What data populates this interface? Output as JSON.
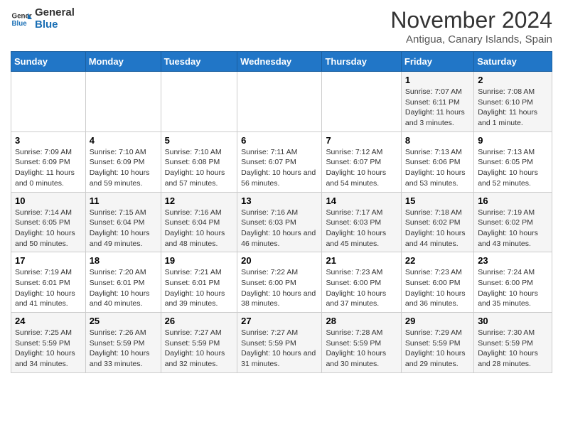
{
  "header": {
    "logo_general": "General",
    "logo_blue": "Blue",
    "month_title": "November 2024",
    "location": "Antigua, Canary Islands, Spain"
  },
  "calendar": {
    "columns": [
      "Sunday",
      "Monday",
      "Tuesday",
      "Wednesday",
      "Thursday",
      "Friday",
      "Saturday"
    ],
    "weeks": [
      [
        {
          "day": "",
          "info": ""
        },
        {
          "day": "",
          "info": ""
        },
        {
          "day": "",
          "info": ""
        },
        {
          "day": "",
          "info": ""
        },
        {
          "day": "",
          "info": ""
        },
        {
          "day": "1",
          "info": "Sunrise: 7:07 AM\nSunset: 6:11 PM\nDaylight: 11 hours and 3 minutes."
        },
        {
          "day": "2",
          "info": "Sunrise: 7:08 AM\nSunset: 6:10 PM\nDaylight: 11 hours and 1 minute."
        }
      ],
      [
        {
          "day": "3",
          "info": "Sunrise: 7:09 AM\nSunset: 6:09 PM\nDaylight: 11 hours and 0 minutes."
        },
        {
          "day": "4",
          "info": "Sunrise: 7:10 AM\nSunset: 6:09 PM\nDaylight: 10 hours and 59 minutes."
        },
        {
          "day": "5",
          "info": "Sunrise: 7:10 AM\nSunset: 6:08 PM\nDaylight: 10 hours and 57 minutes."
        },
        {
          "day": "6",
          "info": "Sunrise: 7:11 AM\nSunset: 6:07 PM\nDaylight: 10 hours and 56 minutes."
        },
        {
          "day": "7",
          "info": "Sunrise: 7:12 AM\nSunset: 6:07 PM\nDaylight: 10 hours and 54 minutes."
        },
        {
          "day": "8",
          "info": "Sunrise: 7:13 AM\nSunset: 6:06 PM\nDaylight: 10 hours and 53 minutes."
        },
        {
          "day": "9",
          "info": "Sunrise: 7:13 AM\nSunset: 6:05 PM\nDaylight: 10 hours and 52 minutes."
        }
      ],
      [
        {
          "day": "10",
          "info": "Sunrise: 7:14 AM\nSunset: 6:05 PM\nDaylight: 10 hours and 50 minutes."
        },
        {
          "day": "11",
          "info": "Sunrise: 7:15 AM\nSunset: 6:04 PM\nDaylight: 10 hours and 49 minutes."
        },
        {
          "day": "12",
          "info": "Sunrise: 7:16 AM\nSunset: 6:04 PM\nDaylight: 10 hours and 48 minutes."
        },
        {
          "day": "13",
          "info": "Sunrise: 7:16 AM\nSunset: 6:03 PM\nDaylight: 10 hours and 46 minutes."
        },
        {
          "day": "14",
          "info": "Sunrise: 7:17 AM\nSunset: 6:03 PM\nDaylight: 10 hours and 45 minutes."
        },
        {
          "day": "15",
          "info": "Sunrise: 7:18 AM\nSunset: 6:02 PM\nDaylight: 10 hours and 44 minutes."
        },
        {
          "day": "16",
          "info": "Sunrise: 7:19 AM\nSunset: 6:02 PM\nDaylight: 10 hours and 43 minutes."
        }
      ],
      [
        {
          "day": "17",
          "info": "Sunrise: 7:19 AM\nSunset: 6:01 PM\nDaylight: 10 hours and 41 minutes."
        },
        {
          "day": "18",
          "info": "Sunrise: 7:20 AM\nSunset: 6:01 PM\nDaylight: 10 hours and 40 minutes."
        },
        {
          "day": "19",
          "info": "Sunrise: 7:21 AM\nSunset: 6:01 PM\nDaylight: 10 hours and 39 minutes."
        },
        {
          "day": "20",
          "info": "Sunrise: 7:22 AM\nSunset: 6:00 PM\nDaylight: 10 hours and 38 minutes."
        },
        {
          "day": "21",
          "info": "Sunrise: 7:23 AM\nSunset: 6:00 PM\nDaylight: 10 hours and 37 minutes."
        },
        {
          "day": "22",
          "info": "Sunrise: 7:23 AM\nSunset: 6:00 PM\nDaylight: 10 hours and 36 minutes."
        },
        {
          "day": "23",
          "info": "Sunrise: 7:24 AM\nSunset: 6:00 PM\nDaylight: 10 hours and 35 minutes."
        }
      ],
      [
        {
          "day": "24",
          "info": "Sunrise: 7:25 AM\nSunset: 5:59 PM\nDaylight: 10 hours and 34 minutes."
        },
        {
          "day": "25",
          "info": "Sunrise: 7:26 AM\nSunset: 5:59 PM\nDaylight: 10 hours and 33 minutes."
        },
        {
          "day": "26",
          "info": "Sunrise: 7:27 AM\nSunset: 5:59 PM\nDaylight: 10 hours and 32 minutes."
        },
        {
          "day": "27",
          "info": "Sunrise: 7:27 AM\nSunset: 5:59 PM\nDaylight: 10 hours and 31 minutes."
        },
        {
          "day": "28",
          "info": "Sunrise: 7:28 AM\nSunset: 5:59 PM\nDaylight: 10 hours and 30 minutes."
        },
        {
          "day": "29",
          "info": "Sunrise: 7:29 AM\nSunset: 5:59 PM\nDaylight: 10 hours and 29 minutes."
        },
        {
          "day": "30",
          "info": "Sunrise: 7:30 AM\nSunset: 5:59 PM\nDaylight: 10 hours and 28 minutes."
        }
      ]
    ]
  }
}
